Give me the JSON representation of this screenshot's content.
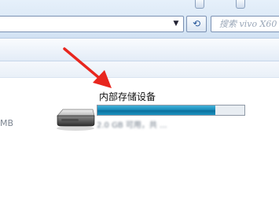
{
  "search": {
    "placeholder": "搜索 vivo X60"
  },
  "address_bar": {
    "dropdown_icon": "chevron-down-icon"
  },
  "refresh": {
    "icon": "refresh-icon"
  },
  "left_item": {
    "size_fragment": "MB"
  },
  "drive": {
    "name": "内部存储设备",
    "capacity_used_fraction": 0.8,
    "free_text": "2.0 GB 可用，共 ...",
    "icon": "hard-drive-icon"
  },
  "annotation": {
    "icon": "red-arrow-icon",
    "color": "#e8261e"
  },
  "colors": {
    "accent": "#1a8dbb",
    "chrome": "#d2e2f3"
  }
}
